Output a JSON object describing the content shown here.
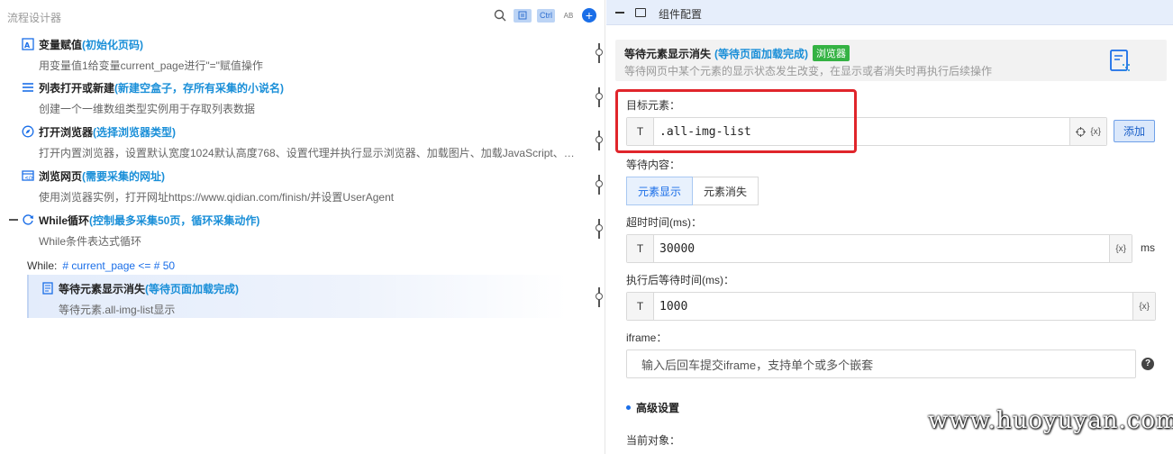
{
  "left_panel": {
    "title": "流程设计器",
    "header_icons": {
      "ctrl_label": "Ctrl",
      "ab_label": "AB"
    },
    "steps": [
      {
        "title": "变量赋值",
        "note": "(初始化页码)",
        "desc": "用变量值1给变量current_page进行\"=\"赋值操作",
        "icon": "variable-icon"
      },
      {
        "title": "列表打开或新建",
        "note": "(新建空盒子，存所有采集的小说名)",
        "desc": "创建一个一维数组类型实例用于存取列表数据",
        "icon": "list-icon"
      },
      {
        "title": "打开浏览器",
        "note": "(选择浏览器类型)",
        "desc": "打开内置浏览器，设置默认宽度1024默认高度768、设置代理并执行显示浏览器、加载图片、加载JavaScript、…",
        "icon": "compass-icon"
      },
      {
        "title": "浏览网页",
        "note": "(需要采集的网址)",
        "desc": "使用浏览器实例，打开网址https://www.qidian.com/finish/并设置UserAgent",
        "icon": "browser-icon"
      },
      {
        "title": "While循环",
        "note": " (控制最多采集50页，循环采集动作)",
        "desc": "While条件表达式循环",
        "icon": "loop-icon"
      }
    ],
    "while_expr": {
      "label": "While:",
      "value": "# current_page <= # 50"
    },
    "selected_step": {
      "title": "等待元素显示消失",
      "note": "(等待页面加载完成)",
      "desc": "等待元素.all-img-list显示",
      "icon": "wait-icon"
    }
  },
  "right_panel": {
    "header_title": "组件配置",
    "info": {
      "title": "等待元素显示消失",
      "note": "(等待页面加载完成)",
      "badge": "浏览器",
      "desc": "等待网页中某个元素的显示状态发生改变，在显示或者消失时再执行后续操作"
    },
    "target": {
      "label": "目标元素：",
      "prefix": "T",
      "value": ".all-img-list",
      "var_token": "{x}",
      "add_label": "添加"
    },
    "wait_content": {
      "label": "等待内容：",
      "options": [
        "元素显示",
        "元素消失"
      ],
      "selected": "元素显示"
    },
    "timeout": {
      "label": "超时时间(ms)：",
      "prefix": "T",
      "value": "30000",
      "var_token": "{x}",
      "unit": "ms"
    },
    "after_wait": {
      "label": "执行后等待时间(ms)：",
      "prefix": "T",
      "value": "1000",
      "var_token": "{x}"
    },
    "iframe": {
      "label": "iframe：",
      "placeholder": "输入后回车提交iframe，支持单个或多个嵌套",
      "help": "?"
    },
    "advanced": {
      "label": "高级设置"
    },
    "current_object": {
      "label": "当前对象："
    }
  },
  "watermark": "www.huoyuyan.com",
  "colors": {
    "accent": "#1a6ee8",
    "note_blue": "#1a8fd8",
    "badge_green": "#34b243",
    "highlight_red": "#e0252b"
  }
}
